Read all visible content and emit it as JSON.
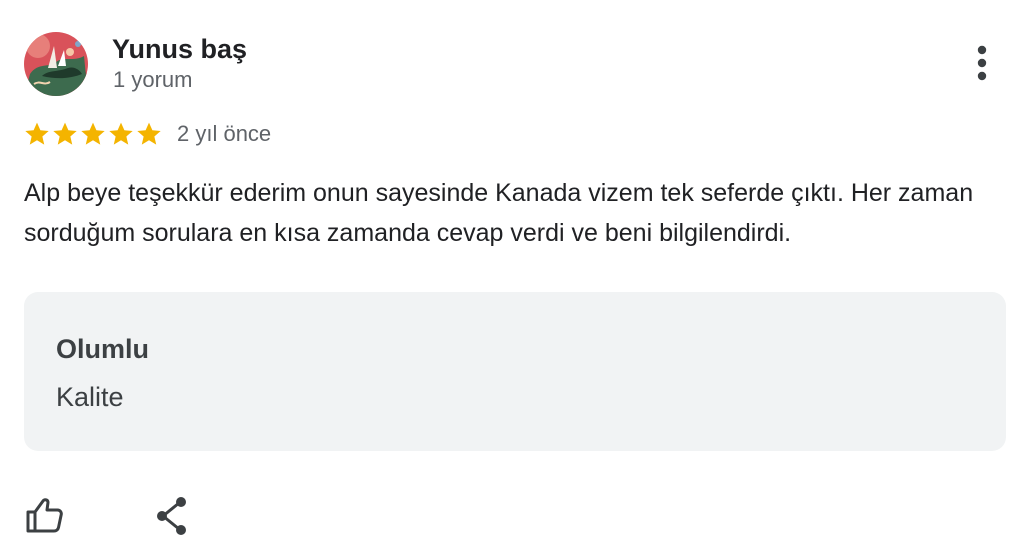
{
  "review": {
    "author": {
      "name": "Yunus baş",
      "meta": "1 yorum",
      "avatar": "painted-avatar-image"
    },
    "rating": {
      "stars": 5,
      "max_stars": 5,
      "date": "2 yıl önce"
    },
    "text": "Alp beye teşekkür ederim onun sayesinde Kanada vizem tek seferde çıktı. Her zaman sorduğum sorulara en kısa zamanda cevap verdi ve beni bilgilendirdi.",
    "attributes": {
      "title": "Olumlu",
      "value": "Kalite"
    },
    "actions": {
      "more_icon": "more-vert-icon",
      "like_icon": "thumb-up-icon",
      "share_icon": "share-icon"
    }
  },
  "colors": {
    "star": "#f4b400",
    "primary_text": "#202124",
    "secondary_text": "#5f6368",
    "attr_background": "#f1f3f4",
    "icon": "#3c4043"
  }
}
